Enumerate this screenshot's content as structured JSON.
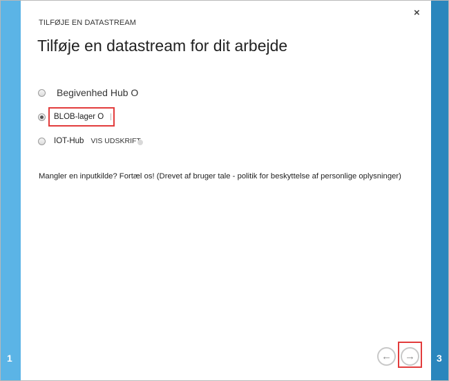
{
  "wizard": {
    "breadcrumb": "TILFØJE EN DATASTREAM",
    "title": "Tilføje en datastream for dit arbejde",
    "close_glyph": "×",
    "options": [
      {
        "label": "Begivenhed Hub O",
        "selected": false
      },
      {
        "label": "BLOB-lager O",
        "selected": true
      },
      {
        "label": "IOT-Hub",
        "selected": false,
        "extra": "VIS UDSKRIFT"
      }
    ],
    "missing_text": "Mangler en inputkilde? Fortæl os! (Drevet af bruger tale - politik for beskyttelse af personlige oplysninger)",
    "steps": {
      "left": "1",
      "right": "3"
    },
    "nav": {
      "back_glyph": "←",
      "next_glyph": "→"
    }
  },
  "colors": {
    "left_bar": "#5bb4e6",
    "right_bar": "#2a86bd",
    "highlight": "#e23b3b"
  },
  "icons": [
    "close-icon",
    "arrow-left-icon",
    "arrow-right-icon"
  ]
}
